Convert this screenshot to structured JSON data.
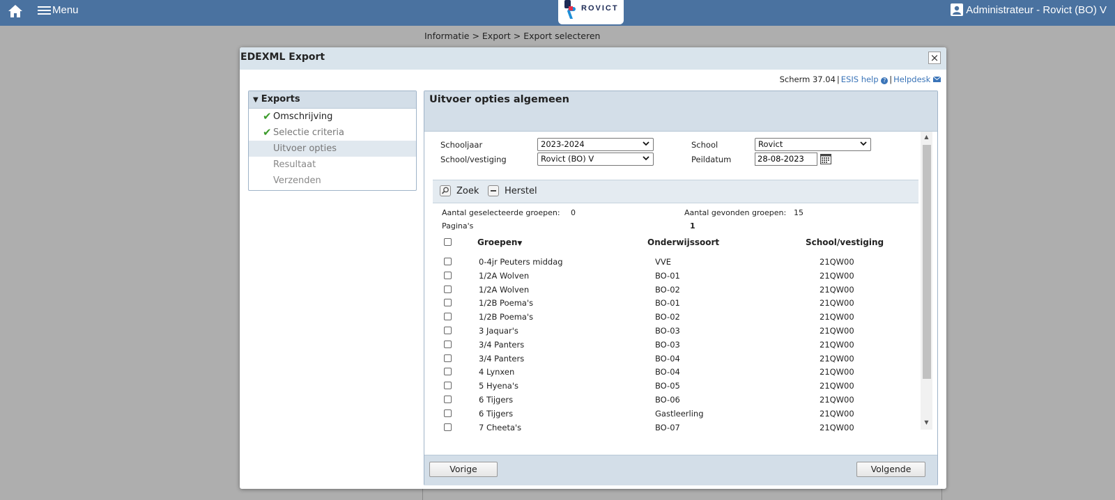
{
  "topbar": {
    "menu_label": "Menu",
    "logo_text": "ROVICT",
    "user_label": "Administrateur - Rovict (BO) V"
  },
  "breadcrumb": "Informatie > Export > Export selecteren",
  "dialog": {
    "title": "EDEXML Export",
    "close_label": "×",
    "screen_id": "Scherm 37.04",
    "help_link": "ESIS help",
    "helpdesk_link": "Helpdesk"
  },
  "nav": {
    "header": "Exports",
    "items": [
      {
        "label": "Omschrijving",
        "state": "done"
      },
      {
        "label": "Selectie criteria",
        "state": "done"
      },
      {
        "label": "Uitvoer opties",
        "state": "active"
      },
      {
        "label": "Resultaat",
        "state": "pending"
      },
      {
        "label": "Verzenden",
        "state": "pending"
      }
    ]
  },
  "panel": {
    "title": "Uitvoer opties algemeen",
    "fields": {
      "schooljaar_label": "Schooljaar",
      "schooljaar_value": "2023-2024",
      "school_label": "School",
      "school_value": "Rovict",
      "vestiging_label": "School/vestiging",
      "vestiging_value": "Rovict (BO) V",
      "peildatum_label": "Peildatum",
      "peildatum_value": "28-08-2023"
    },
    "search": {
      "zoek_label": "Zoek",
      "herstel_label": "Herstel"
    },
    "stats": {
      "selected_label": "Aantal geselecteerde groepen:",
      "selected_value": "0",
      "found_label": "Aantal gevonden groepen:",
      "found_value": "15",
      "pages_label": "Pagina's",
      "pages_value": "1"
    },
    "table": {
      "headers": {
        "groepen": "Groepen",
        "onderwijssoort": "Onderwijssoort",
        "vestiging": "School/vestiging"
      },
      "rows": [
        {
          "groep": "0-4jr Peuters middag",
          "soort": "VVE",
          "vestiging": "21QW00"
        },
        {
          "groep": "1/2A Wolven",
          "soort": "BO-01",
          "vestiging": "21QW00"
        },
        {
          "groep": "1/2A Wolven",
          "soort": "BO-02",
          "vestiging": "21QW00"
        },
        {
          "groep": "1/2B Poema's",
          "soort": "BO-01",
          "vestiging": "21QW00"
        },
        {
          "groep": "1/2B Poema's",
          "soort": "BO-02",
          "vestiging": "21QW00"
        },
        {
          "groep": "3 Jaquar's",
          "soort": "BO-03",
          "vestiging": "21QW00"
        },
        {
          "groep": "3/4 Panters",
          "soort": "BO-03",
          "vestiging": "21QW00"
        },
        {
          "groep": "3/4 Panters",
          "soort": "BO-04",
          "vestiging": "21QW00"
        },
        {
          "groep": "4 Lynxen",
          "soort": "BO-04",
          "vestiging": "21QW00"
        },
        {
          "groep": "5 Hyena's",
          "soort": "BO-05",
          "vestiging": "21QW00"
        },
        {
          "groep": "6 Tijgers",
          "soort": "BO-06",
          "vestiging": "21QW00"
        },
        {
          "groep": "6 Tijgers",
          "soort": "Gastleerling",
          "vestiging": "21QW00"
        },
        {
          "groep": "7 Cheeta's",
          "soort": "BO-07",
          "vestiging": "21QW00"
        }
      ]
    },
    "footer": {
      "prev_label": "Vorige",
      "next_label": "Volgende"
    }
  },
  "colors": {
    "topbar": "#4a72a0",
    "panel_header": "#d3dee8",
    "check": "#3c9b2b",
    "link": "#3a74b8"
  }
}
